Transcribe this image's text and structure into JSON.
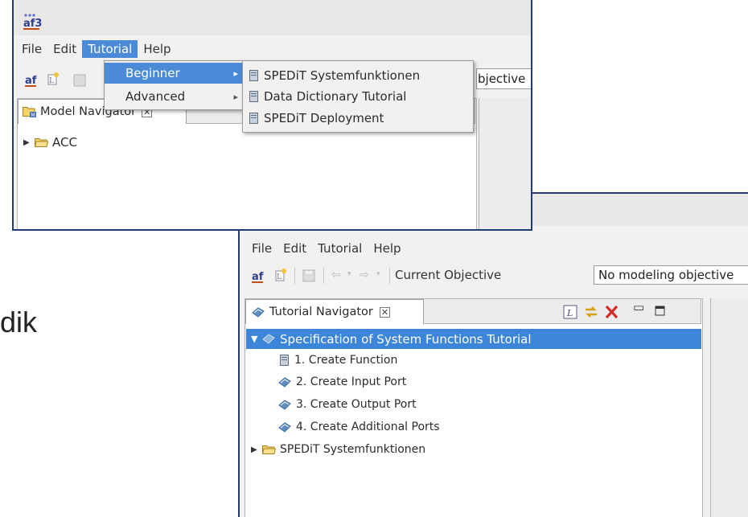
{
  "slide": {
    "partial_text": "dik"
  },
  "window_top": {
    "logo_text": "af3",
    "menu": [
      "File",
      "Edit",
      "Tutorial",
      "Help"
    ],
    "toolbar_partial_text": "bjective",
    "panel_tab": {
      "label": "Model Navigator",
      "close": "✕"
    },
    "tree": [
      {
        "label": "ACC"
      }
    ],
    "tutorial_menu": {
      "items": [
        {
          "label": "Beginner",
          "selected": true,
          "arrow": "▸"
        },
        {
          "label": "Advanced",
          "selected": false,
          "arrow": "▸"
        }
      ]
    },
    "beginner_submenu": {
      "items": [
        {
          "label": "SPEDiT Systemfunktionen"
        },
        {
          "label": "Data Dictionary Tutorial"
        },
        {
          "label": "SPEDiT Deployment"
        }
      ]
    }
  },
  "window_bottom": {
    "menu": [
      "File",
      "Edit",
      "Tutorial",
      "Help"
    ],
    "toolbar": {
      "objective_label": "Current Objective",
      "objective_value": "No modeling objective"
    },
    "panel_tab": {
      "label": "Tutorial Navigator",
      "close": "✕"
    },
    "tree": {
      "root": {
        "label": "Specification of System Functions Tutorial",
        "expanded": true,
        "selected": true
      },
      "children": [
        {
          "label": "1. Create Function",
          "icon": "page-icon"
        },
        {
          "label": "2. Create Input Port",
          "icon": "book-icon"
        },
        {
          "label": "3. Create Output Port",
          "icon": "book-icon"
        },
        {
          "label": "4. Create Additional Ports",
          "icon": "book-icon"
        }
      ],
      "second": {
        "label": "SPEDiT Systemfunktionen",
        "expanded": false
      }
    }
  },
  "colors": {
    "selection": "#4a8ad6",
    "tree_selection": "#3d85d8",
    "window_border": "#1f3c73",
    "close_red": "#d42a2a"
  }
}
